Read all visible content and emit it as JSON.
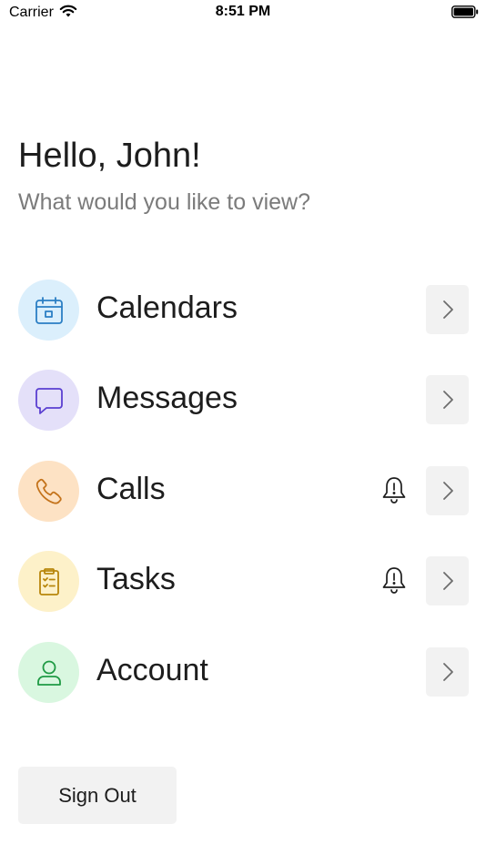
{
  "status_bar": {
    "carrier": "Carrier",
    "time": "8:51 PM"
  },
  "greeting": "Hello, John!",
  "subtitle": "What would you like to view?",
  "menu": [
    {
      "label": "Calendars",
      "icon": "calendar-icon",
      "icon_bg": "#dbeffc",
      "icon_color": "#2b7fc4",
      "alert": false
    },
    {
      "label": "Messages",
      "icon": "message-icon",
      "icon_bg": "#e4e0f9",
      "icon_color": "#5a3fd1",
      "alert": false
    },
    {
      "label": "Calls",
      "icon": "phone-icon",
      "icon_bg": "#fde2c4",
      "icon_color": "#c4731b",
      "alert": true
    },
    {
      "label": "Tasks",
      "icon": "clipboard-icon",
      "icon_bg": "#fdf1c9",
      "icon_color": "#b8860b",
      "alert": true
    },
    {
      "label": "Account",
      "icon": "person-icon",
      "icon_bg": "#d9f7e0",
      "icon_color": "#1f9a44",
      "alert": false
    }
  ],
  "sign_out_label": "Sign Out"
}
